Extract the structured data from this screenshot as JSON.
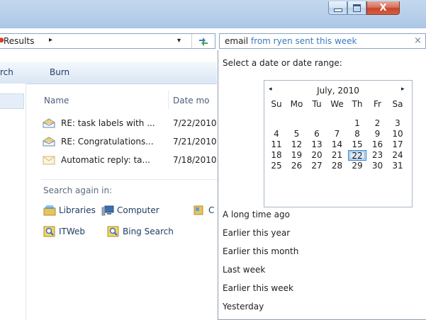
{
  "window": {
    "buttons": {
      "minimize_icon": "minimize-icon",
      "maximize_icon": "maximize-icon",
      "close_glyph": "X"
    }
  },
  "address_bar": {
    "crumb": "Results",
    "separator": "▸",
    "dropdown_glyph": "▾",
    "refresh_icon": "refresh-icon"
  },
  "search_box": {
    "term": "email",
    "filter": "from ryen sent this week",
    "clear_glyph": "×"
  },
  "toolbar": {
    "search_label": "rch",
    "burn_label": "Burn"
  },
  "columns": {
    "name": "Name",
    "date": "Date mo"
  },
  "files": [
    {
      "name": "RE: task labels with ...",
      "date": "7/22/2010",
      "icon": "opened-envelope-icon"
    },
    {
      "name": "RE: Congratulations...",
      "date": "7/21/2010",
      "icon": "opened-envelope-icon"
    },
    {
      "name": "Automatic reply: ta...",
      "date": "7/18/2010",
      "icon": "closed-envelope-icon"
    }
  ],
  "search_again": {
    "label": "Search again in:",
    "locations": [
      {
        "label": "Libraries",
        "icon": "libraries-icon"
      },
      {
        "label": "Computer",
        "icon": "computer-icon"
      },
      {
        "label": "C",
        "icon": "custom-icon"
      },
      {
        "label": "ITWeb",
        "icon": "search-provider-icon"
      },
      {
        "label": "Bing Search",
        "icon": "search-provider-icon"
      }
    ]
  },
  "date_picker": {
    "prompt": "Select a date or date range:",
    "calendar": {
      "month_label": "July, 2010",
      "prev_glyph": "◂",
      "next_glyph": "▸",
      "weekdays": [
        "Su",
        "Mo",
        "Tu",
        "We",
        "Th",
        "Fr",
        "Sa"
      ],
      "weeks": [
        [
          "",
          "",
          "",
          "",
          "1",
          "2",
          "3"
        ],
        [
          "4",
          "5",
          "6",
          "7",
          "8",
          "9",
          "10"
        ],
        [
          "11",
          "12",
          "13",
          "14",
          "15",
          "16",
          "17"
        ],
        [
          "18",
          "19",
          "20",
          "21",
          "22",
          "23",
          "24"
        ],
        [
          "25",
          "26",
          "27",
          "28",
          "29",
          "30",
          "31"
        ]
      ],
      "today": "22"
    },
    "presets": [
      "A long time ago",
      "Earlier this year",
      "Earlier this month",
      "Last week",
      "Earlier this week",
      "Yesterday"
    ]
  },
  "colors": {
    "accent": "#3a7bbf",
    "titlebar": "#b7cfe9",
    "close_button": "#c7462f"
  }
}
